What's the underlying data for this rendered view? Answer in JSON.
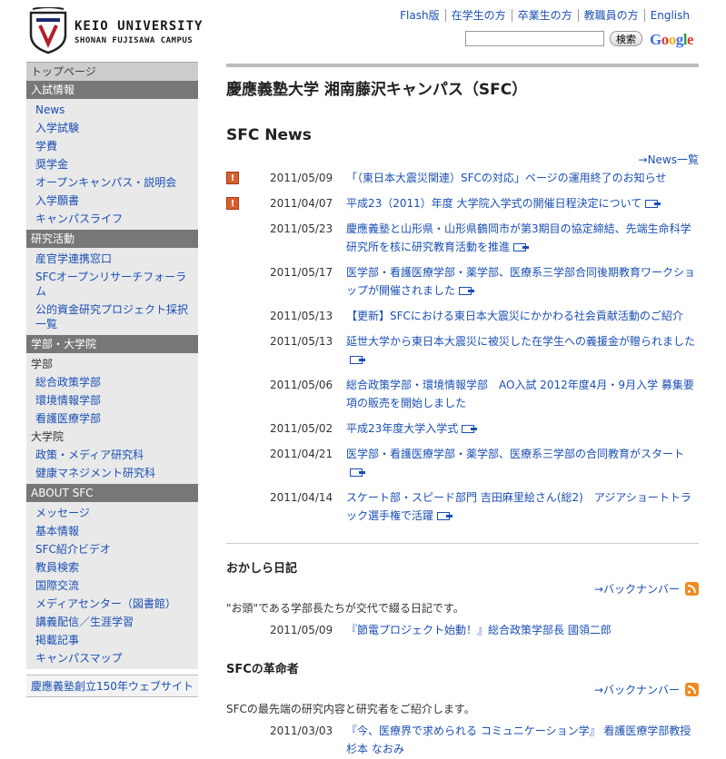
{
  "header": {
    "logo_line1": "KEIO UNIVERSITY",
    "logo_line2": "SHONAN FUJISAWA CAMPUS",
    "nav": [
      "Flash版",
      "在学生の方",
      "卒業生の方",
      "教職員の方",
      "English"
    ],
    "search_button": "検索",
    "google": "Google"
  },
  "sidebar": {
    "top": "トップページ",
    "nyushi": {
      "title": "入試情報",
      "items": [
        "News",
        "入学試験",
        "学費",
        "奨学金",
        "オープンキャンパス・説明会",
        "入学願書",
        "キャンパスライフ"
      ]
    },
    "kenkyu": {
      "title": "研究活動",
      "items": [
        "産官学連携窓口",
        "SFCオープンリサーチフォーラム",
        "公的資金研究プロジェクト採択一覧"
      ]
    },
    "gakubu": {
      "title": "学部・大学院",
      "sub1": "学部",
      "items1": [
        "総合政策学部",
        "環境情報学部",
        "看護医療学部"
      ],
      "sub2": "大学院",
      "items2": [
        "政策・メディア研究科",
        "健康マネジメント研究科"
      ]
    },
    "about": {
      "title": "ABOUT SFC",
      "items": [
        "メッセージ",
        "基本情報",
        "SFC紹介ビデオ",
        "教員検索",
        "国際交流",
        "メディアセンター（図書館）",
        "講義配信／生涯学習",
        "掲載記事",
        "キャンパスマップ"
      ]
    },
    "extra": "慶應義塾創立150年ウェブサイト"
  },
  "main": {
    "title": "慶應義塾大学 湘南藤沢キャンパス（SFC）",
    "news_heading": "SFC News",
    "news_more": "→News一覧",
    "news": [
      {
        "date": "2011/05/09",
        "title": "「（東日本大震災関連）SFCの対応」ページの運用終了のお知らせ"
      },
      {
        "date": "2011/04/07",
        "title": "平成23（2011）年度 大学院入学式の開催日程決定について"
      },
      {
        "date": "2011/05/23",
        "title": "慶應義塾と山形県・山形県鶴岡市が第3期目の協定締結、先端生命科学研究所を核に研究教育活動を推進"
      },
      {
        "date": "2011/05/17",
        "title": "医学部・看護医療学部・薬学部、医療系三学部合同後期教育ワークショップが開催されました"
      },
      {
        "date": "2011/05/13",
        "title": "【更新】SFCにおける東日本大震災にかかわる社会貢献活動のご紹介"
      },
      {
        "date": "2011/05/13",
        "title": "延世大学から東日本大震災に被災した在学生への義援金が贈られました"
      },
      {
        "date": "2011/05/06",
        "title": "総合政策学部・環境情報学部　AO入試 2012年度4月・9月入学 募集要項の販売を開始しました"
      },
      {
        "date": "2011/05/02",
        "title": "平成23年度大学入学式"
      },
      {
        "date": "2011/04/21",
        "title": "医学部・看護医療学部・薬学部、医療系三学部の合同教育がスタート"
      },
      {
        "date": "2011/04/14",
        "title": "スケート部・スピード部門 吉田麻里絵さん(総2)　アジアショートトラック選手権で活躍"
      }
    ],
    "okashira": {
      "heading": "おかしら日記",
      "more": "→バックナンバー",
      "desc": "\"お頭\"である学部長たちが交代で綴る日記です。",
      "date": "2011/05/09",
      "title": "『節電プロジェクト始動！』総合政策学部長 國領二郎"
    },
    "kakumei": {
      "heading": "SFCの革命者",
      "more": "→バックナンバー",
      "desc": "SFCの最先端の研究内容と研究者をご紹介します。",
      "date": "2011/03/03",
      "title": "『今、医療界で求められる コミュニケーション学』 看護医療学部教授 杉本 なおみ"
    }
  }
}
